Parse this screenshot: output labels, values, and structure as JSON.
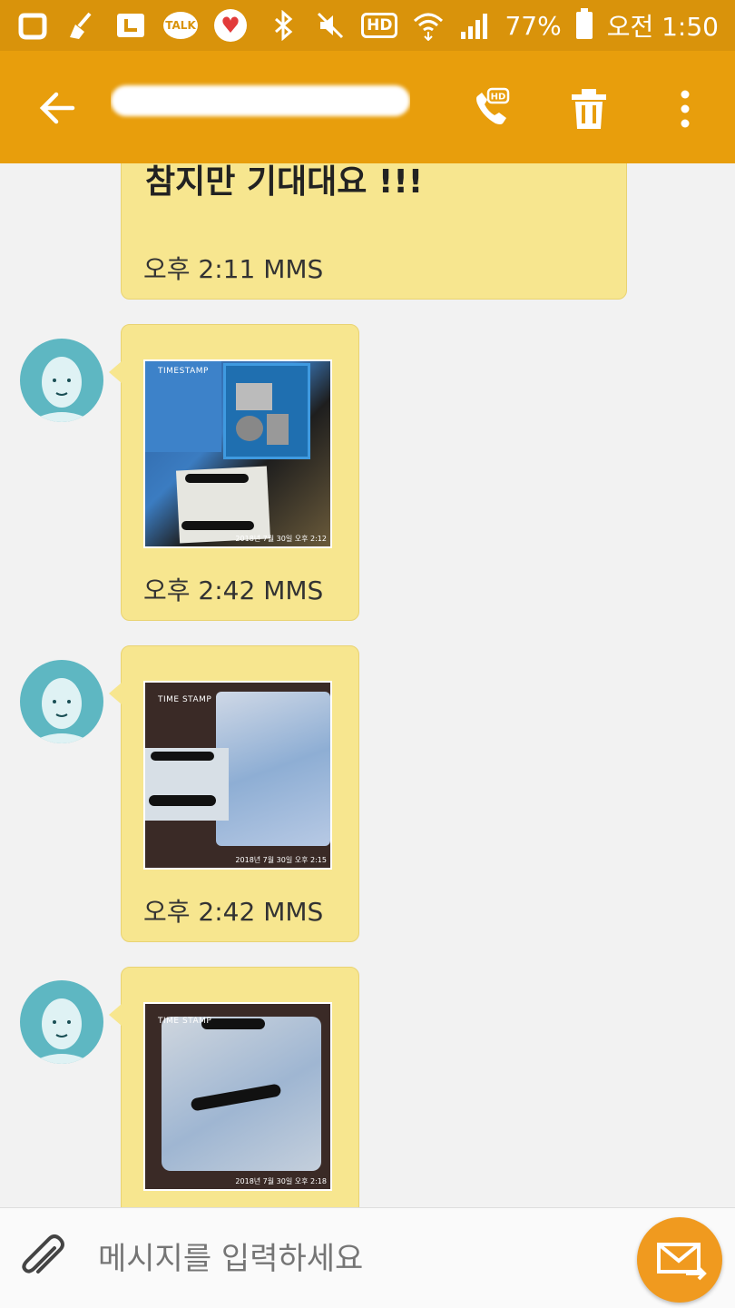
{
  "status_bar": {
    "battery": "77%",
    "time": "오전 1:50",
    "hd_badge": "HD",
    "talk_label": "TALK",
    "icons": [
      "o-app-icon",
      "broom-icon",
      "l-app-icon",
      "kakaotalk-icon",
      "heart-icon",
      "bluetooth-icon",
      "mute-icon",
      "hd-icon",
      "wifi-icon",
      "signal-icon",
      "battery-icon"
    ]
  },
  "app_bar": {
    "contact_name": "",
    "call_badge": "HD",
    "icons": [
      "back-arrow-icon",
      "hd-call-icon",
      "trash-icon",
      "more-vert-icon"
    ]
  },
  "colors": {
    "status_bar": "#d9930b",
    "app_bar": "#e89e0c",
    "bubble": "#f7e68f",
    "avatar": "#5eb7c2",
    "send_button": "#f09a1f"
  },
  "messages": [
    {
      "text": "참지만 기대대요 !!!",
      "time": "오후 2:11 MMS"
    },
    {
      "time": "오후 2:42 MMS",
      "photo_brand": "TIMESTAMP",
      "photo_stamp": "2018년 7월 30일 오후 2:12"
    },
    {
      "time": "오후 2:42 MMS",
      "photo_brand": "TIME STAMP",
      "photo_stamp": "2018년 7월 30일 오후 2:15"
    },
    {
      "time": "",
      "photo_brand": "TIME STAMP",
      "photo_stamp": "2018년 7월 30일 오후 2:18"
    }
  ],
  "composer": {
    "placeholder": "메시지를 입력하세요"
  }
}
